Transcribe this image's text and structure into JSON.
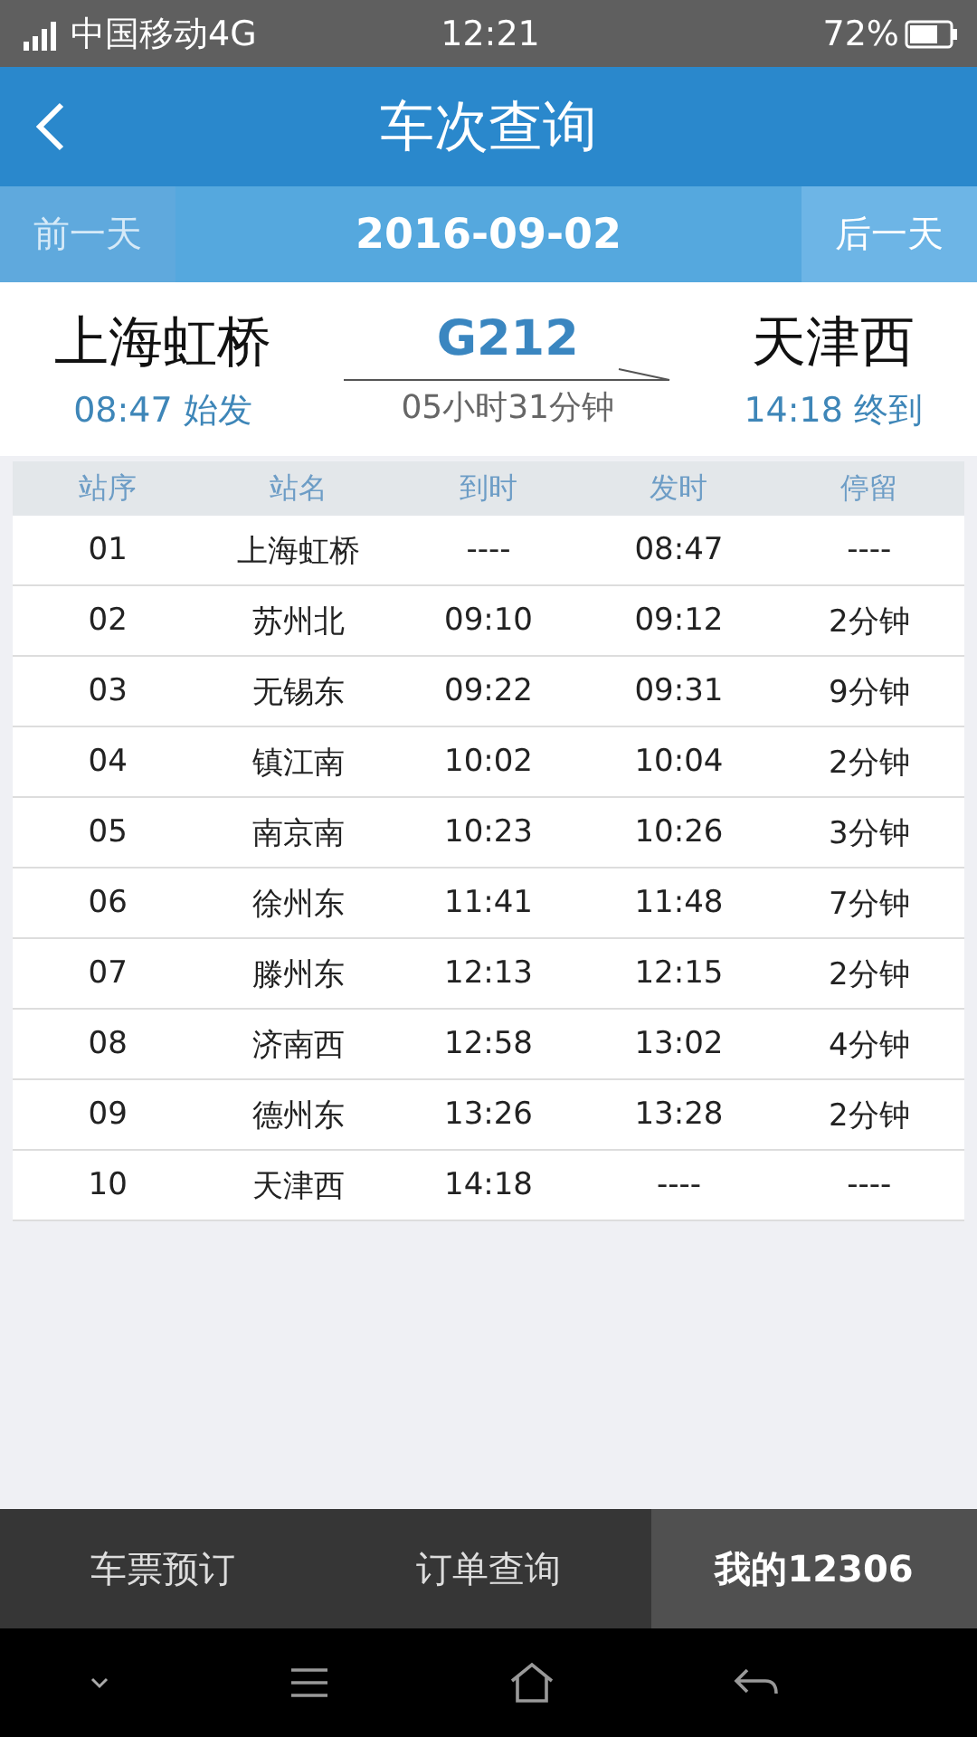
{
  "status_bar": {
    "carrier": "中国移动4G",
    "time": "12:21",
    "battery": "72%"
  },
  "header": {
    "title": "车次查询"
  },
  "date_bar": {
    "prev": {
      "label": "前一天",
      "disabled": true
    },
    "date": "2016-09-02",
    "next": {
      "label": "后一天",
      "disabled": false
    }
  },
  "train": {
    "from": "上海虹桥",
    "depart": "08:47 始发",
    "number": "G212",
    "duration": "05小时31分钟",
    "to": "天津西",
    "arrive": "14:18 终到"
  },
  "table": {
    "columns": [
      "站序",
      "站名",
      "到时",
      "发时",
      "停留"
    ],
    "rows": [
      [
        "01",
        "上海虹桥",
        "----",
        "08:47",
        "----"
      ],
      [
        "02",
        "苏州北",
        "09:10",
        "09:12",
        "2分钟"
      ],
      [
        "03",
        "无锡东",
        "09:22",
        "09:31",
        "9分钟"
      ],
      [
        "04",
        "镇江南",
        "10:02",
        "10:04",
        "2分钟"
      ],
      [
        "05",
        "南京南",
        "10:23",
        "10:26",
        "3分钟"
      ],
      [
        "06",
        "徐州东",
        "11:41",
        "11:48",
        "7分钟"
      ],
      [
        "07",
        "滕州东",
        "12:13",
        "12:15",
        "2分钟"
      ],
      [
        "08",
        "济南西",
        "12:58",
        "13:02",
        "4分钟"
      ],
      [
        "09",
        "德州东",
        "13:26",
        "13:28",
        "2分钟"
      ],
      [
        "10",
        "天津西",
        "14:18",
        "----",
        "----"
      ]
    ]
  },
  "tabs": [
    {
      "label": "车票预订",
      "selected": false
    },
    {
      "label": "订单查询",
      "selected": false
    },
    {
      "label": "我的12306",
      "selected": true
    }
  ]
}
